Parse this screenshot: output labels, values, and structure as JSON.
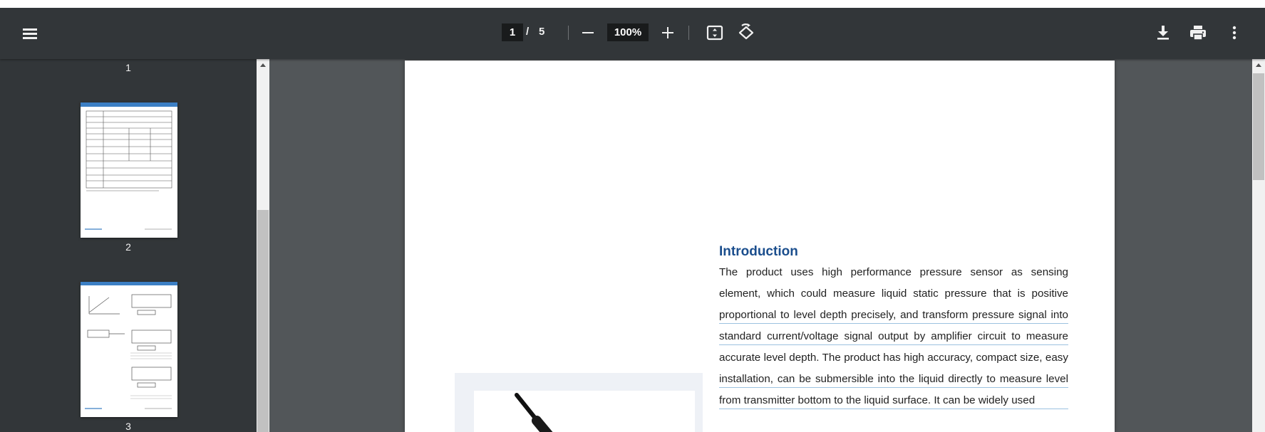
{
  "toolbar": {
    "current_page": "1",
    "separator": "/",
    "total_pages": "5",
    "zoom": "100%",
    "icons": [
      "menu-icon",
      "zoom-out-icon",
      "zoom-in-icon",
      "fit-page-icon",
      "rotate-icon",
      "download-icon",
      "print-icon",
      "more-vert-icon"
    ]
  },
  "sidebar": {
    "thumbnail_numbers": [
      "1",
      "2",
      "3"
    ]
  },
  "document": {
    "heading": "Introduction",
    "body": "The product uses high performance pressure sensor as sensing element, which could measure liquid static pressure that is positive proportional to level depth precisely, and transform pressure signal into standard current/voltage signal output by amplifier circuit to measure accurate level depth. The product has high accuracy, compact size, easy installation, can be submersible into the liquid directly to measure level from transmitter bottom to the liquid surface. It can be widely used"
  },
  "colors": {
    "toolbar": "#323639",
    "viewer_bg": "#525659",
    "heading": "#1b4e8d",
    "accent_thumb": "#3c7fc4"
  }
}
